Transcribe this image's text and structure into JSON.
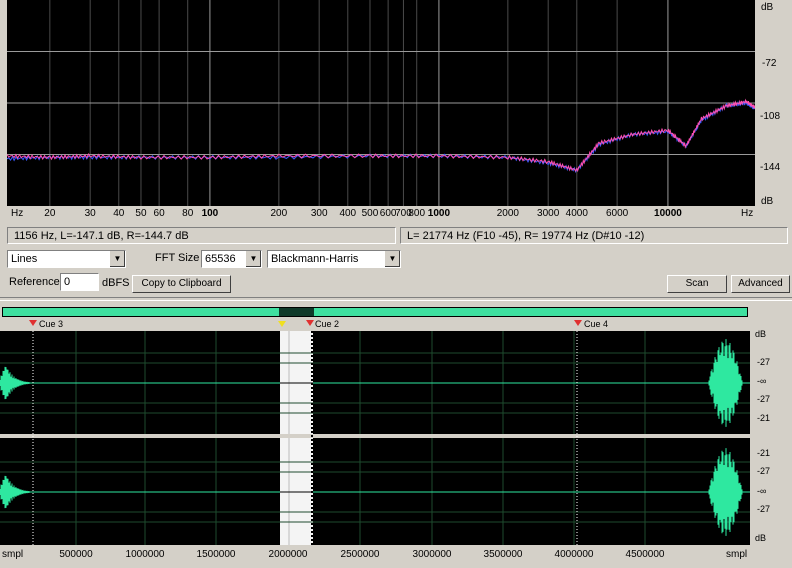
{
  "spectrum": {
    "y_unit_top": "dB",
    "y_unit_bottom": "dB",
    "y_ticks": [
      "-72",
      "-108",
      "-144"
    ],
    "x_unit_left": "Hz",
    "x_unit_right": "Hz",
    "x_ticks": [
      "20",
      "30",
      "40",
      "50",
      "60",
      "80",
      "100",
      "200",
      "300",
      "400",
      "500",
      "600",
      "700",
      "800",
      "1000",
      "2000",
      "3000",
      "4000",
      "6000",
      "10000"
    ],
    "x_ticks_bold": [
      "100",
      "1000",
      "10000"
    ],
    "colors": {
      "left": "#3b5bff",
      "right": "#ff4fb0",
      "grid": "#4a4a4a",
      "bg": "#000000"
    }
  },
  "chart_data": {
    "type": "line",
    "xlabel": "Hz",
    "ylabel": "dB",
    "x_scale": "log",
    "xlim": [
      13,
      24000
    ],
    "ylim": [
      -180,
      -36
    ],
    "series": [
      {
        "values": [
          [
            13,
            -147
          ],
          [
            20,
            -146
          ],
          [
            30,
            -146
          ],
          [
            50,
            -146
          ],
          [
            100,
            -146
          ],
          [
            200,
            -146
          ],
          [
            500,
            -145
          ],
          [
            1000,
            -145
          ],
          [
            2000,
            -146
          ],
          [
            3000,
            -150
          ],
          [
            4000,
            -155
          ],
          [
            5000,
            -137
          ],
          [
            7000,
            -130
          ],
          [
            10000,
            -128
          ],
          [
            12000,
            -138
          ],
          [
            14000,
            -120
          ],
          [
            18000,
            -110
          ],
          [
            22000,
            -108
          ],
          [
            24000,
            -112
          ]
        ]
      },
      {
        "values": [
          [
            13,
            -145
          ],
          [
            20,
            -146
          ],
          [
            30,
            -145
          ],
          [
            50,
            -146
          ],
          [
            100,
            -146
          ],
          [
            200,
            -145
          ],
          [
            500,
            -145
          ],
          [
            1000,
            -145
          ],
          [
            2000,
            -146
          ],
          [
            3000,
            -149
          ],
          [
            4000,
            -155
          ],
          [
            5000,
            -136
          ],
          [
            7000,
            -130
          ],
          [
            10000,
            -127
          ],
          [
            12000,
            -138
          ],
          [
            14000,
            -119
          ],
          [
            18000,
            -110
          ],
          [
            22000,
            -107
          ],
          [
            24000,
            -111
          ]
        ]
      }
    ]
  },
  "status": {
    "left": "1156 Hz, L=-147.1 dB, R=-144.7 dB",
    "right": "L=  21774 Hz (F10 -45), R=  19774 Hz (D#10 -12)"
  },
  "controls": {
    "graph_type": "Lines",
    "fft_label": "FFT Size",
    "fft_size": "65536",
    "window": "Blackmann-Harris",
    "reference_label": "Reference",
    "reference_value": "0",
    "reference_unit": "dBFS",
    "copy_label": "Copy to Clipboard",
    "scan_label": "Scan",
    "advanced_label": "Advanced"
  },
  "waveform": {
    "cues": [
      "Cue 3",
      "Cue 2",
      "Cue 4"
    ],
    "channel_ticks": [
      "dB",
      "-27",
      "-∞",
      "-27",
      "-21"
    ],
    "channel_ticks_2": [
      "-21",
      "-27",
      "-∞",
      "-27",
      "dB"
    ],
    "x_unit_left": "smpl",
    "x_unit_right": "smpl",
    "x_ticks": [
      "500000",
      "1000000",
      "1500000",
      "2000000",
      "2500000",
      "3000000",
      "3500000",
      "4000000",
      "4500000"
    ],
    "colors": {
      "wave": "#2ee8a0",
      "overview": "#3fe0a0"
    }
  }
}
